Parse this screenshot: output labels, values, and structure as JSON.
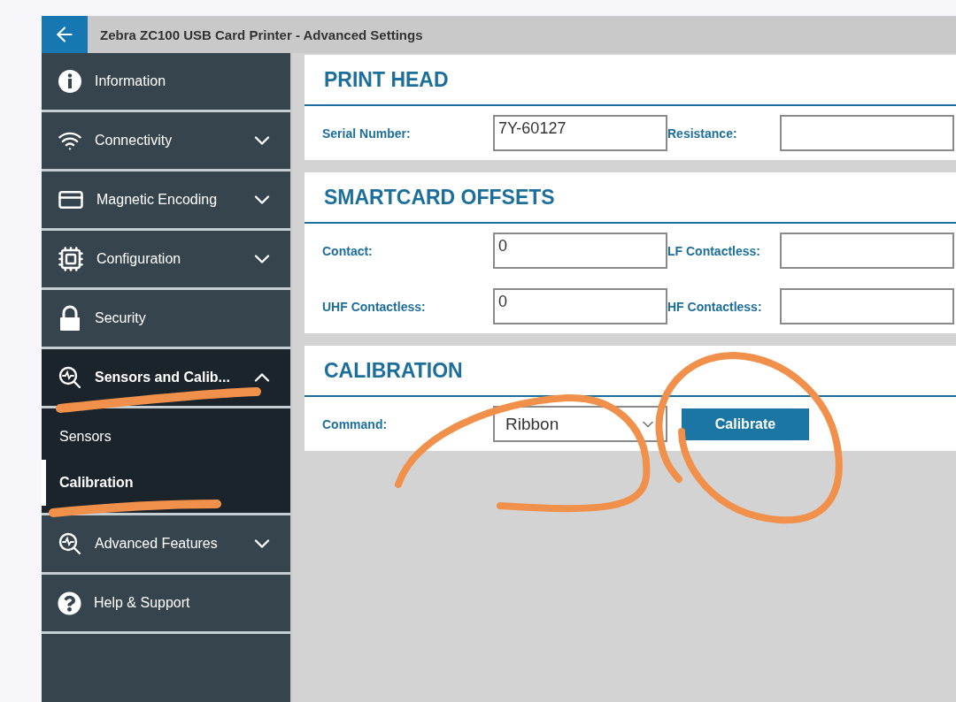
{
  "window": {
    "title": "Zebra ZC100 USB Card Printer - Advanced Settings"
  },
  "sidebar": {
    "items": [
      {
        "label": "Information",
        "selected": false
      },
      {
        "label": "Connectivity",
        "selected": false,
        "expanded": false
      },
      {
        "label": "Magnetic Encoding",
        "selected": false,
        "expanded": false
      },
      {
        "label": "Configuration",
        "selected": false,
        "expanded": false
      },
      {
        "label": "Security",
        "selected": false
      },
      {
        "label": "Sensors and Calib...",
        "selected": true,
        "expanded": true,
        "children": [
          {
            "label": "Sensors",
            "selected": false
          },
          {
            "label": "Calibration",
            "selected": true
          }
        ]
      },
      {
        "label": "Advanced Features",
        "selected": false,
        "expanded": false
      },
      {
        "label": "Help & Support",
        "selected": false
      }
    ]
  },
  "sections": [
    {
      "title": "PRINT HEAD",
      "rows": [
        [
          {
            "label": "Serial Number:",
            "kind": "text",
            "value": "7Y-60127"
          },
          {
            "label": "Resistance:",
            "kind": "text"
          }
        ]
      ]
    },
    {
      "title": "SMARTCARD OFFSETS",
      "rows": [
        [
          {
            "label": "Contact:",
            "kind": "text",
            "value": "0"
          },
          {
            "label": "LF Contactless:",
            "kind": "text"
          }
        ],
        [
          {
            "label": "UHF Contactless:",
            "kind": "text",
            "value": "0"
          },
          {
            "label": "HF Contactless:",
            "kind": "text"
          }
        ]
      ]
    },
    {
      "title": "CALIBRATION",
      "rows": [
        [
          {
            "label": "Command:",
            "kind": "dropdown",
            "value": "Ribbon",
            "button": "Calibrate"
          }
        ]
      ]
    }
  ],
  "markup": [
    {
      "kind": "underline"
    },
    {
      "kind": "underline"
    },
    {
      "kind": "circle"
    },
    {
      "kind": "circle"
    }
  ]
}
